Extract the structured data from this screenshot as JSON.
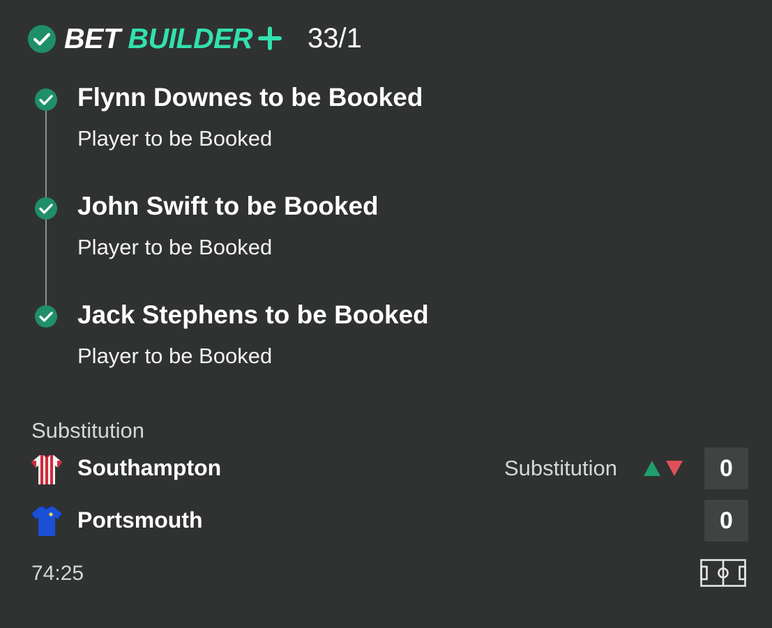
{
  "header": {
    "brand_part1": "BET",
    "brand_part2": "BUILDER",
    "odds": "33/1",
    "colors": {
      "accent": "#33e0ad",
      "check_fill": "#1f8f69"
    },
    "icons": [
      "check-circle-icon",
      "plus-icon"
    ]
  },
  "legs": [
    {
      "title": "Flynn Downes to be Booked",
      "market": "Player to be Booked"
    },
    {
      "title": "John Swift to be Booked",
      "market": "Player to be Booked"
    },
    {
      "title": "Jack Stephens to be Booked",
      "market": "Player to be Booked"
    }
  ],
  "match": {
    "latest_event": "Substitution",
    "home": {
      "name": "Southampton",
      "score": "0",
      "event": "Substitution",
      "kit_icon": "striped-shirt-icon"
    },
    "away": {
      "name": "Portsmouth",
      "score": "0",
      "kit_icon": "blue-shirt-icon"
    },
    "clock": "74:25",
    "event_arrow_colors": {
      "in": "#1f9e6e",
      "out": "#e0505a"
    },
    "pitch_icon": "pitch-view-icon"
  }
}
